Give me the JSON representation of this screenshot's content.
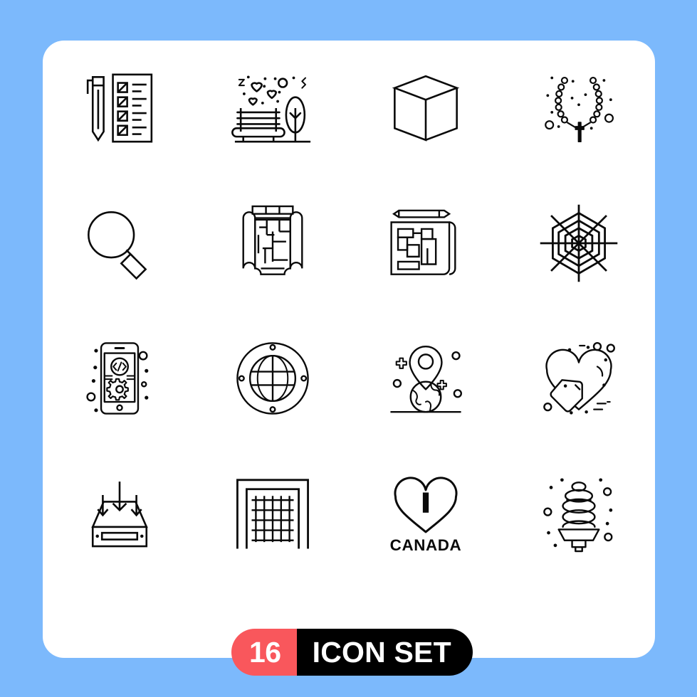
{
  "canvas": {
    "background_color": "#7cb9fc",
    "card_color": "#ffffff"
  },
  "banner": {
    "count": "16",
    "label": "ICON SET",
    "count_bg_color": "#f9575c",
    "label_bg_color": "#000000",
    "text_color": "#ffffff"
  },
  "icons": {
    "stroke_color": "#0a0a0a",
    "items": [
      {
        "name": "pen-checklist-icon",
        "label": "Pen and checklist"
      },
      {
        "name": "park-bench-hearts-icon",
        "label": "Park bench with hearts and tree"
      },
      {
        "name": "cube-icon",
        "label": "3D cube"
      },
      {
        "name": "rosary-beads-icon",
        "label": "Rosary with cross"
      },
      {
        "name": "magnifying-glass-icon",
        "label": "Magnifying glass"
      },
      {
        "name": "floor-plan-scroll-icon",
        "label": "Floor plan blueprint scroll"
      },
      {
        "name": "blueprint-pencil-icon",
        "label": "Blueprint with pencil"
      },
      {
        "name": "spider-web-icon",
        "label": "Spider web"
      },
      {
        "name": "mobile-app-development-icon",
        "label": "Mobile app development"
      },
      {
        "name": "porthole-window-icon",
        "label": "Porthole window"
      },
      {
        "name": "location-pin-globe-icon",
        "label": "Location pin with globe"
      },
      {
        "name": "heart-tag-icon",
        "label": "Heart with price tag"
      },
      {
        "name": "inbox-download-icon",
        "label": "Inbox download tray"
      },
      {
        "name": "soccer-goal-icon",
        "label": "Soccer goal net"
      },
      {
        "name": "i-love-canada-icon",
        "label": "I love Canada"
      },
      {
        "name": "cfl-lightbulb-icon",
        "label": "CFL light bulb"
      }
    ]
  },
  "canada_text": "CANADA"
}
